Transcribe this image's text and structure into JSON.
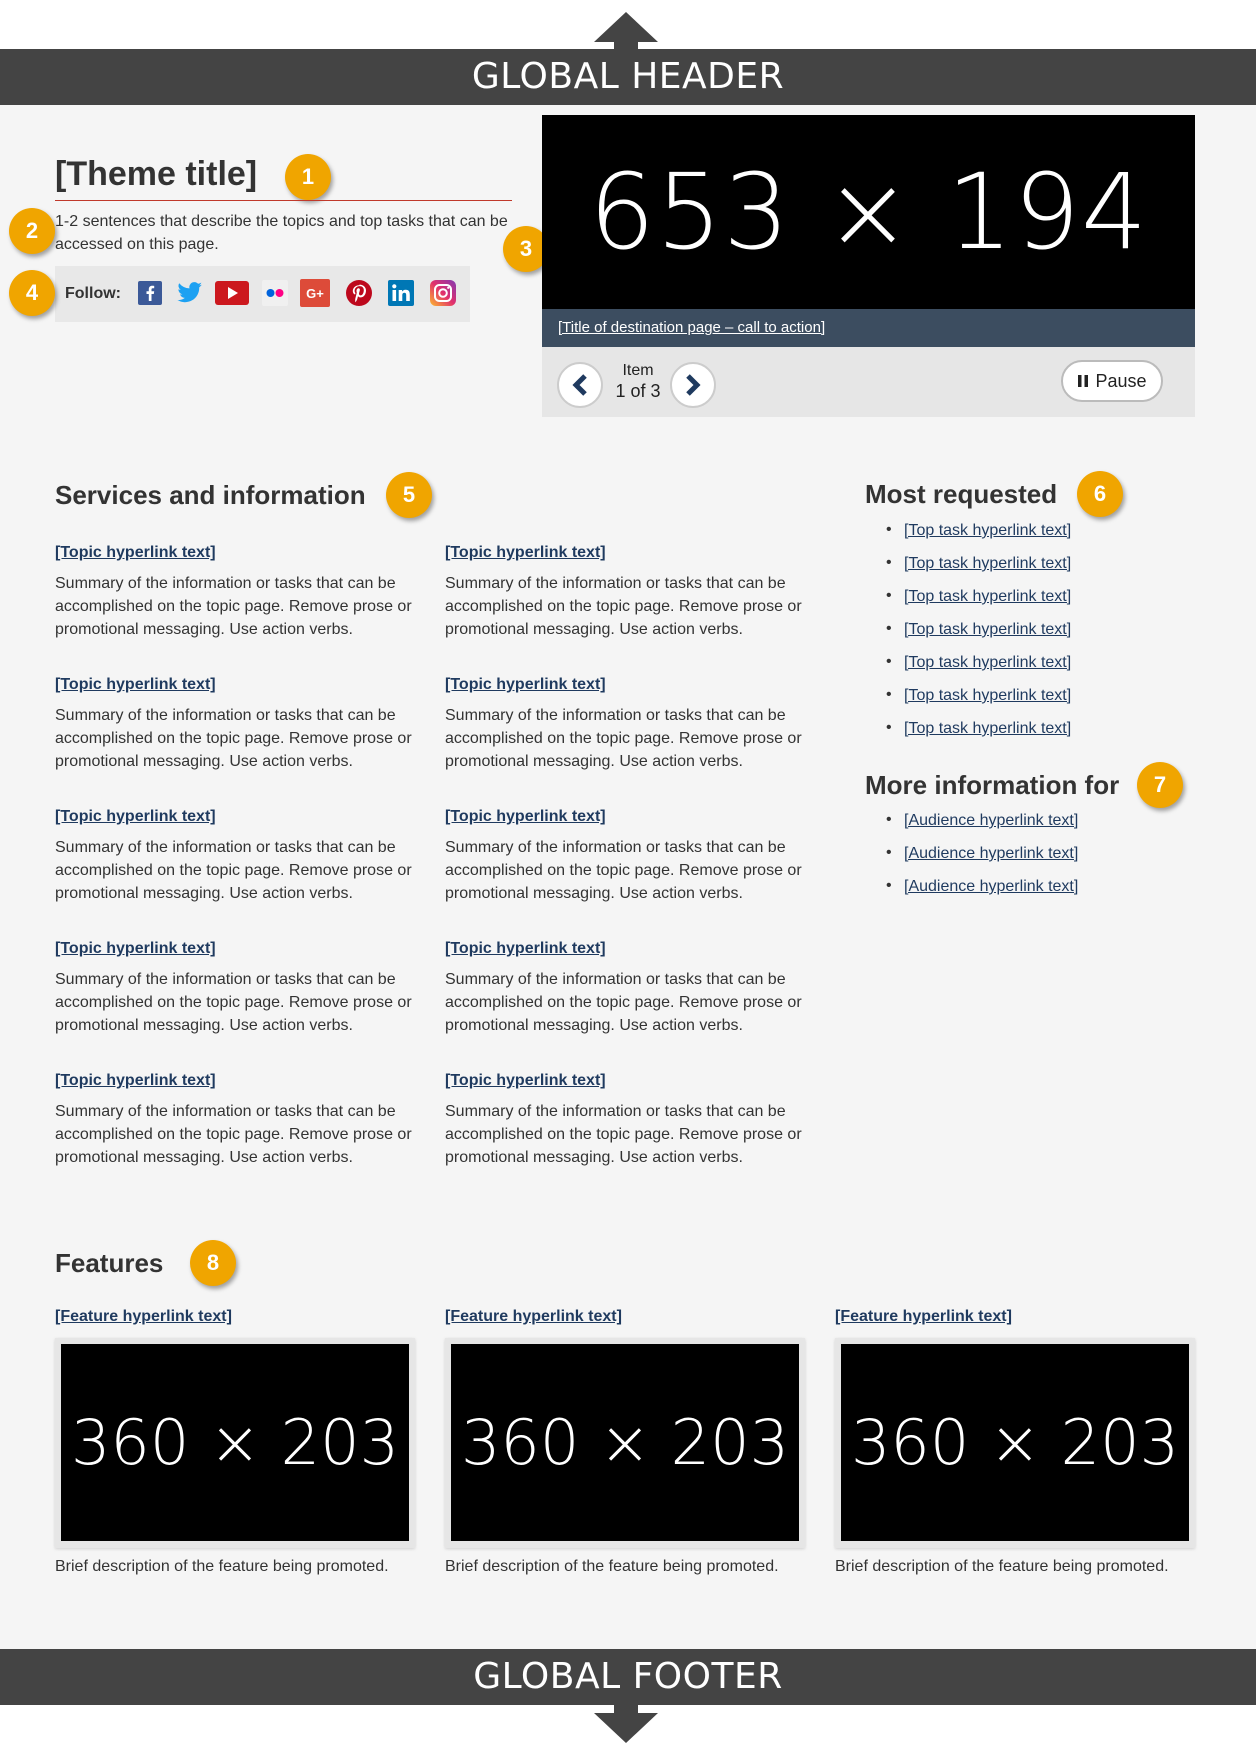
{
  "global_header": {
    "label": "GLOBAL HEADER"
  },
  "global_footer": {
    "label": "GLOBAL FOOTER"
  },
  "badges": [
    "1",
    "2",
    "3",
    "4",
    "5",
    "6",
    "7",
    "8"
  ],
  "theme": {
    "title": "[Theme title]",
    "description": "1-2 sentences that describe the topics and top tasks that can be accessed on this page."
  },
  "follow": {
    "label": "Follow:",
    "icons": [
      "facebook-icon",
      "twitter-icon",
      "youtube-icon",
      "flickr-icon",
      "google-plus-icon",
      "pinterest-icon",
      "linkedin-icon",
      "instagram-icon"
    ]
  },
  "carousel": {
    "image_label": "653 × 194",
    "caption_link": "[Title of destination page – call to action]",
    "item_label": "Item",
    "item_count": "1 of 3",
    "pause_label": "Pause"
  },
  "services": {
    "heading": "Services and information",
    "topics": [
      {
        "link": "[Topic hyperlink text]",
        "summary": "Summary of the information or tasks that can be accomplished on the topic page. Remove prose or promotional messaging. Use action verbs."
      },
      {
        "link": "[Topic hyperlink text]",
        "summary": "Summary of the information or tasks that can be accomplished on the topic page. Remove prose or promotional messaging. Use action verbs."
      },
      {
        "link": "[Topic hyperlink text]",
        "summary": "Summary of the information or tasks that can be accomplished on the topic page. Remove prose or promotional messaging. Use action verbs."
      },
      {
        "link": "[Topic hyperlink text]",
        "summary": "Summary of the information or tasks that can be accomplished on the topic page. Remove prose or promotional messaging. Use action verbs."
      },
      {
        "link": "[Topic hyperlink text]",
        "summary": "Summary of the information or tasks that can be accomplished on the topic page. Remove prose or promotional messaging. Use action verbs."
      },
      {
        "link": "[Topic hyperlink text]",
        "summary": "Summary of the information or tasks that can be accomplished on the topic page. Remove prose or promotional messaging. Use action verbs."
      },
      {
        "link": "[Topic hyperlink text]",
        "summary": "Summary of the information or tasks that can be accomplished on the topic page. Remove prose or promotional messaging. Use action verbs."
      },
      {
        "link": "[Topic hyperlink text]",
        "summary": "Summary of the information or tasks that can be accomplished on the topic page. Remove prose or promotional messaging. Use action verbs."
      },
      {
        "link": "[Topic hyperlink text]",
        "summary": "Summary of the information or tasks that can be accomplished on the topic page. Remove prose or promotional messaging. Use action verbs."
      },
      {
        "link": "[Topic hyperlink text]",
        "summary": "Summary of the information or tasks that can be accomplished on the topic page. Remove prose or promotional messaging. Use action verbs."
      }
    ]
  },
  "most_requested": {
    "heading": "Most requested",
    "items": [
      "[Top task hyperlink text]",
      "[Top task hyperlink text]",
      "[Top task hyperlink text]",
      "[Top task hyperlink text]",
      "[Top task hyperlink text]",
      "[Top task hyperlink text]",
      "[Top task hyperlink text]"
    ]
  },
  "more_info": {
    "heading": "More information for",
    "items": [
      "[Audience hyperlink text]",
      "[Audience hyperlink text]",
      "[Audience hyperlink text]"
    ]
  },
  "features": {
    "heading": "Features",
    "items": [
      {
        "link": "[Feature hyperlink text]",
        "image_label": "360 × 203",
        "description": "Brief description of the feature being promoted."
      },
      {
        "link": "[Feature hyperlink text]",
        "image_label": "360 × 203",
        "description": "Brief description of the feature being promoted."
      },
      {
        "link": "[Feature hyperlink text]",
        "image_label": "360 × 203",
        "description": "Brief description of the feature being promoted."
      }
    ]
  },
  "colors": {
    "accent_badge": "#f0a500",
    "link": "#1f3a5f",
    "caption_bar": "#3c4d60",
    "title_rule": "#c0392b"
  }
}
